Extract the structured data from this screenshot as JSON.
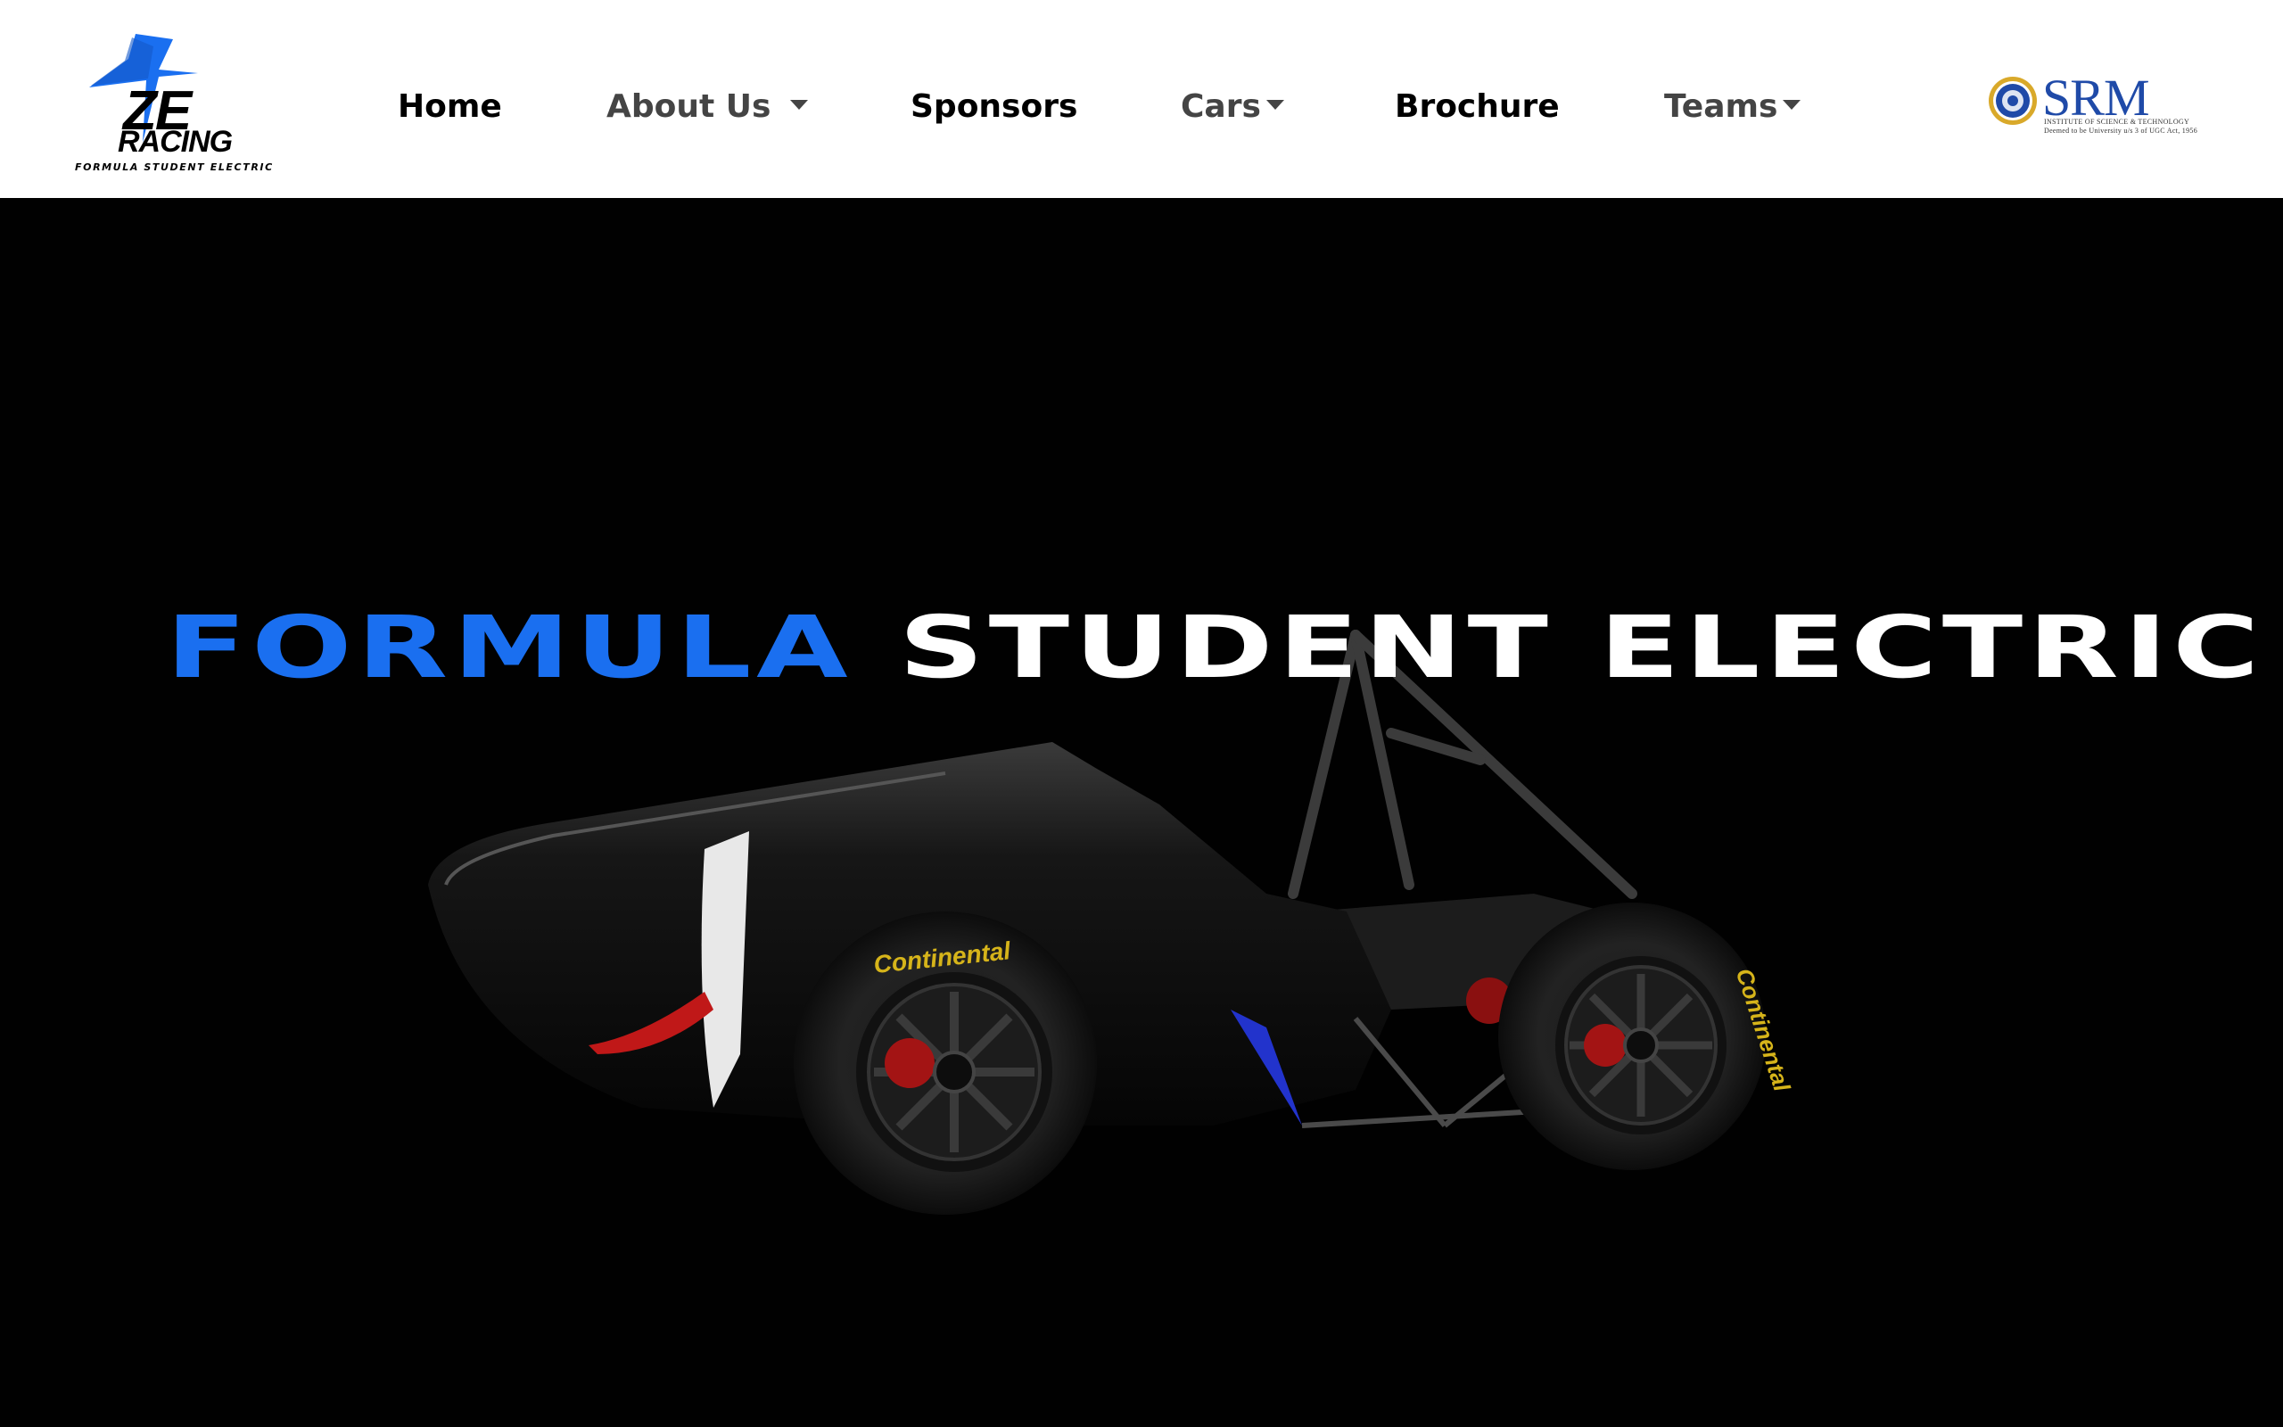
{
  "brand": {
    "logo_mark": "ZE",
    "logo_word": "RACING",
    "tagline": "FORMULA STUDENT ELECTRIC",
    "accent_color": "#1a6ff0"
  },
  "nav": {
    "items": [
      {
        "label": "Home",
        "dropdown": false,
        "color": "#000000"
      },
      {
        "label": "About Us",
        "dropdown": true,
        "color": "#444444"
      },
      {
        "label": "Sponsors",
        "dropdown": false,
        "color": "#000000"
      },
      {
        "label": "Cars",
        "dropdown": true,
        "color": "#444444"
      },
      {
        "label": "Brochure",
        "dropdown": false,
        "color": "#000000"
      },
      {
        "label": "Teams",
        "dropdown": true,
        "color": "#444444"
      }
    ]
  },
  "partner": {
    "name": "SRM",
    "subtitle_line1": "INSTITUTE OF SCIENCE & TECHNOLOGY",
    "subtitle_line2": "Deemed to be University u/s 3 of UGC Act, 1956",
    "color": "#1f4aa8"
  },
  "hero": {
    "title_part1": "FORMULA",
    "title_part2": "STUDENT ELECTRIC",
    "tire_brand": "Continental",
    "background": "#010101"
  }
}
